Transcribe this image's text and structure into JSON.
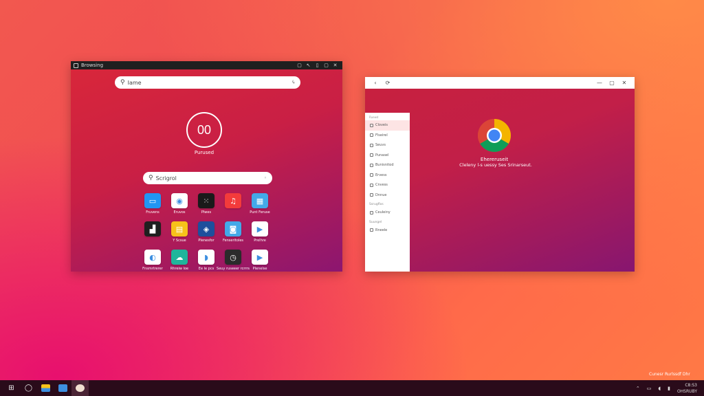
{
  "colors": {
    "accent_blue": "#4a90e2",
    "taskbar_bg": "#2a0b1a",
    "window_red": "#c91f45"
  },
  "window1": {
    "title": "Browsing",
    "controls": [
      "▢",
      "↖",
      "▯",
      "▢",
      "✕"
    ],
    "search_top": {
      "placeholder": "Iame",
      "icon": "search-icon"
    },
    "clock": {
      "value": "00",
      "label": "Purused"
    },
    "search_mid": {
      "placeholder": "Scrigrol",
      "icon": "search-icon"
    },
    "apps": [
      {
        "label": "Fruvens",
        "icon": "monitor-icon",
        "color": "#2196f3"
      },
      {
        "label": "Eruvos",
        "icon": "chrome-icon",
        "color": "#ffffff"
      },
      {
        "label": "Plwes",
        "icon": "dots-icon",
        "color": "#1a1a1a"
      },
      {
        "label": "",
        "icon": "music-icon",
        "color": "#f33b3b"
      },
      {
        "label": "Punt Feruse",
        "icon": "calendar-icon",
        "color": "#43a9e8"
      },
      {
        "label": "",
        "icon": "chart-icon",
        "color": "#1f1f1f"
      },
      {
        "label": "Y Scsue",
        "icon": "folder-icon",
        "color": "#f7c21a"
      },
      {
        "label": "Plenesfor",
        "icon": "photo-icon",
        "color": "#1e4f9c"
      },
      {
        "label": "Fenseritoles",
        "icon": "camera-icon",
        "color": "#43a9e8"
      },
      {
        "label": "Prelhre",
        "icon": "play-store-icon",
        "color": "#ffffff"
      },
      {
        "label": "Fnsmrtrerer",
        "icon": "pay-icon",
        "color": "#ffffff"
      },
      {
        "label": "Rhreiw loe",
        "icon": "cloud-icon",
        "color": "#1fb59b"
      },
      {
        "label": "Ee le pcs",
        "icon": "meet-icon",
        "color": "#ffffff"
      },
      {
        "label": "Seuy ruseeer rcrrrs",
        "icon": "clock-app-icon",
        "color": "#2b2b2b"
      },
      {
        "label": "Plenelse",
        "icon": "play-store-icon",
        "color": "#ffffff"
      }
    ]
  },
  "window2": {
    "back": "‹",
    "reload": "⟳",
    "controls": [
      "—",
      "▢",
      "✕"
    ],
    "sidebar": {
      "heading": "Ruewd",
      "items": [
        "Cloveis",
        "Flseirel",
        "Seuvs",
        "Punasel",
        "Bunisnitod",
        "Ervess",
        "Cnvess",
        "Dnnue"
      ],
      "section": "Ssrugflos",
      "items2": [
        "Ceuleiny"
      ],
      "section2": "Suungel",
      "items3": [
        "Rneele"
      ]
    },
    "content": {
      "title": "Ehereruseit",
      "subtitle": "Cleleny l-s uessy Ses Srinarseut."
    }
  },
  "taskbar": {
    "start": "⊞",
    "search": "◯",
    "tray_up": "⌃",
    "clock_line1": "C8:S3",
    "clock_line2": "OHSRUBY"
  },
  "desktop_note": "Cunesr Rurlssdf Dhr"
}
